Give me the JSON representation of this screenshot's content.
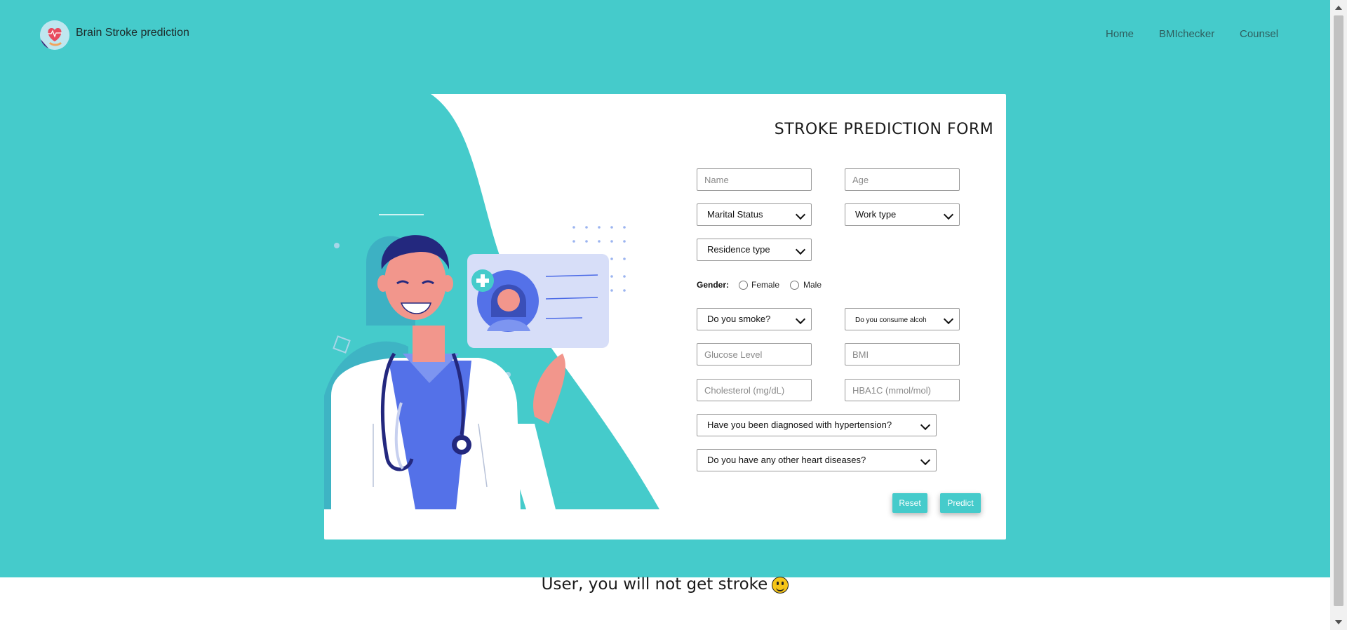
{
  "navbar": {
    "brand": "Brain Stroke prediction",
    "links": [
      "Home",
      "BMIchecker",
      "Counsel"
    ]
  },
  "form": {
    "title": "STROKE PREDICTION FORM",
    "name_placeholder": "Name",
    "age_placeholder": "Age",
    "marital_status": "Marital Status",
    "work_type": "Work type",
    "residence_type": "Residence type",
    "gender_label": "Gender:",
    "gender_options": [
      "Female",
      "Male"
    ],
    "smoke": "Do you smoke?",
    "alcohol": "Do you consume alcoh",
    "glucose_placeholder": "Glucose Level",
    "bmi_placeholder": "BMI",
    "cholesterol_placeholder": "Cholesterol (mg/dL)",
    "hba1c_placeholder": "HBA1C (mmol/mol)",
    "hypertension": "Have you been diagnosed with hypertension?",
    "heart_disease": "Do you have any other heart diseases?",
    "reset_label": "Reset",
    "predict_label": "Predict"
  },
  "result": {
    "text": "User, you will not get stroke"
  },
  "colors": {
    "accent": "#45cbcb",
    "doctor_coat": "#ffffff",
    "doctor_shirt": "#5471e8"
  }
}
